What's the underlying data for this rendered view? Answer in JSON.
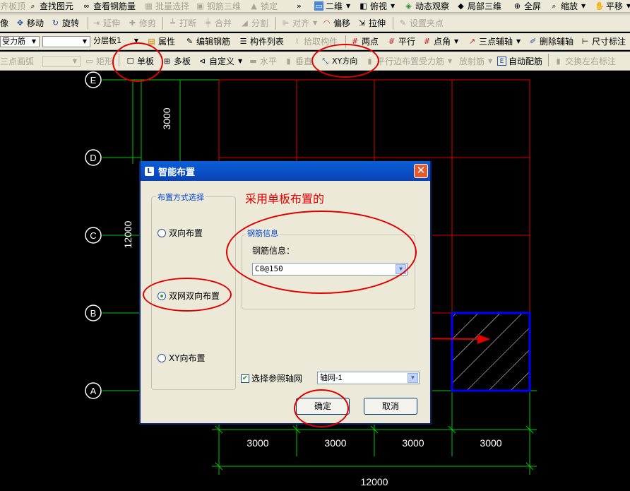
{
  "toolbar_row1": {
    "items": [
      {
        "label": "齐板顶",
        "enabled": false
      },
      {
        "label": "查找图元",
        "enabled": true,
        "icon": "binoculars-icon"
      },
      {
        "label": "查看钢筋量",
        "enabled": true,
        "icon": "rebar-quantity-icon"
      },
      {
        "label": "批量选择",
        "enabled": false
      },
      {
        "label": "钢筋三维",
        "enabled": false
      },
      {
        "label": "锁定",
        "enabled": false
      },
      {
        "label": "二维",
        "enabled": true
      },
      {
        "label": "俯视",
        "enabled": true
      },
      {
        "label": "动态观察",
        "enabled": true
      },
      {
        "label": "局部三维",
        "enabled": true
      },
      {
        "label": "全屏",
        "enabled": true
      },
      {
        "label": "缩放",
        "enabled": true
      },
      {
        "label": "平移",
        "enabled": true
      }
    ],
    "overflow": "»"
  },
  "toolbar_row2": {
    "items": [
      {
        "label": "像",
        "enabled": true
      },
      {
        "label": "移动",
        "enabled": true
      },
      {
        "label": "旋转",
        "enabled": true
      },
      {
        "label": "延伸",
        "enabled": false
      },
      {
        "label": "修剪",
        "enabled": false
      },
      {
        "label": "打断",
        "enabled": false
      },
      {
        "label": "合并",
        "enabled": false
      },
      {
        "label": "分割",
        "enabled": false
      },
      {
        "label": "对齐",
        "enabled": false
      },
      {
        "label": "偏移",
        "enabled": true
      },
      {
        "label": "拉伸",
        "enabled": true
      },
      {
        "label": "设置夹点",
        "enabled": false
      }
    ]
  },
  "toolbar_row3": {
    "type_combo": "受力筋",
    "blank_combo": "",
    "layer_combo": "分层板1",
    "items": [
      {
        "label": "属性",
        "enabled": true
      },
      {
        "label": "编辑钢筋",
        "enabled": true
      },
      {
        "label": "构件列表",
        "enabled": true
      },
      {
        "label": "拾取构件",
        "enabled": false
      },
      {
        "label": "两点",
        "enabled": true
      },
      {
        "label": "平行",
        "enabled": true
      },
      {
        "label": "点角",
        "enabled": true
      },
      {
        "label": "三点辅轴",
        "enabled": true
      },
      {
        "label": "删除辅轴",
        "enabled": true
      },
      {
        "label": "尺寸标注",
        "enabled": true
      }
    ]
  },
  "toolbar_row4": {
    "items": [
      {
        "label": "三点画弧",
        "enabled": false
      },
      {
        "label": "矩形",
        "enabled": false
      },
      {
        "label": "单板",
        "enabled": true
      },
      {
        "label": "多板",
        "enabled": true
      },
      {
        "label": "自定义",
        "enabled": true
      },
      {
        "label": "水平",
        "enabled": false
      },
      {
        "label": "垂直",
        "enabled": false
      },
      {
        "label": "XY方向",
        "enabled": true
      },
      {
        "label": "平行边布置受力筋",
        "enabled": false
      },
      {
        "label": "放射筋",
        "enabled": false
      },
      {
        "label": "自动配筋",
        "enabled": true
      },
      {
        "label": "交换左右标注",
        "enabled": false
      }
    ]
  },
  "drawing": {
    "axes": [
      "E",
      "D",
      "C",
      "B",
      "A"
    ],
    "left_dims": [
      "3000",
      "12000"
    ],
    "bottom_dims": [
      "3000",
      "3000",
      "3000",
      "3000"
    ],
    "bottom_total": "12000",
    "colors": {
      "grid_green": "#00c800",
      "slab_red": "#e00000",
      "selected_blue": "#0000ff"
    }
  },
  "dialog": {
    "title": "智能布置",
    "method_group_label": "布置方式选择",
    "options": [
      {
        "label": "双向布置",
        "checked": false
      },
      {
        "label": "双网双向布置",
        "checked": true
      },
      {
        "label": "XY向布置",
        "checked": false
      }
    ],
    "rebar_group_label": "钢筋信息",
    "rebar_field_label": "钢筋信息：",
    "rebar_value": "C8@150",
    "axis_grid_checkbox_label": "选择参照轴网",
    "axis_grid_checked": true,
    "axis_grid_value": "轴网-1",
    "ok_label": "确定",
    "cancel_label": "取消"
  },
  "annotation": {
    "note": "采用单板布置的"
  }
}
